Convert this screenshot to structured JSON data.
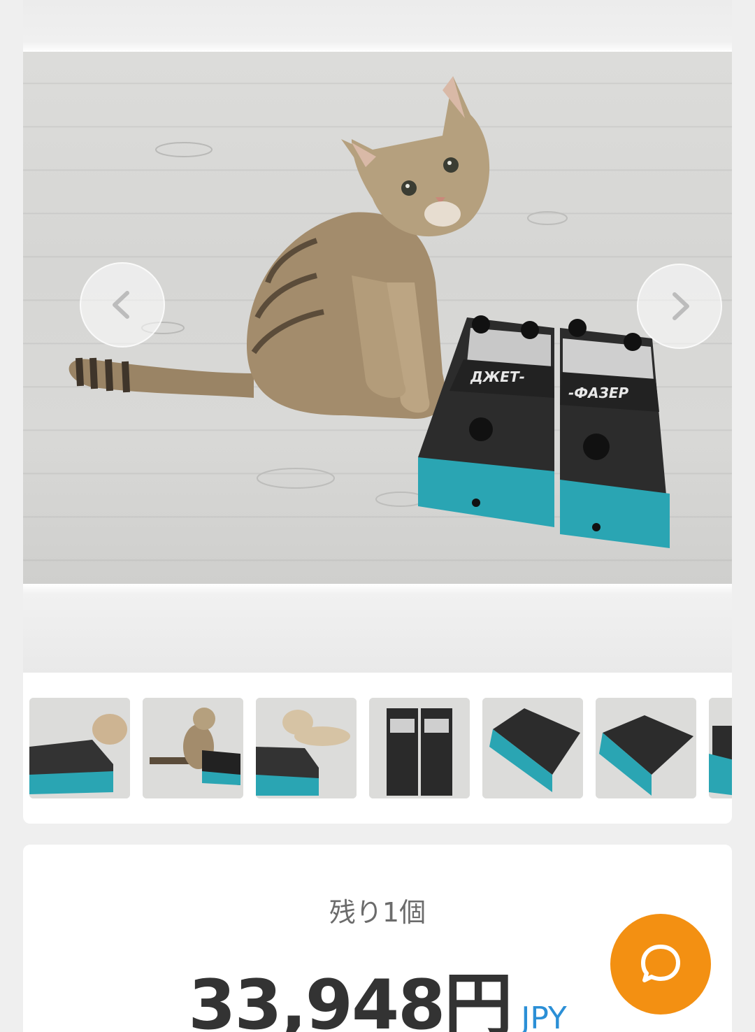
{
  "gallery": {
    "main_image": "tabby kitten sitting next to two teal guitar effect pedals on white wooden floor",
    "main_pedal_labels": [
      "ДЖЕТ-",
      "-ФАЗЕР"
    ],
    "prev_icon": "chevron-left-icon",
    "next_icon": "chevron-right-icon",
    "thumbnails": [
      {
        "icon": "kitten-with-pedals-photo"
      },
      {
        "icon": "kitten-with-pedals-photo"
      },
      {
        "icon": "kitten-with-pedals-photo"
      },
      {
        "icon": "pedals-top-view-photo"
      },
      {
        "icon": "pedals-angle-photo"
      },
      {
        "icon": "pedals-angle-photo"
      },
      {
        "icon": "pedals-angle-photo"
      }
    ]
  },
  "product": {
    "stock_label": "残り1個",
    "price": "33,948円",
    "currency": "JPY"
  },
  "chat": {
    "icon": "chat-bubble-icon"
  },
  "colors": {
    "accent_orange": "#f39012",
    "currency_blue": "#2b8fd6",
    "pedal_teal": "#2aa5b3"
  }
}
